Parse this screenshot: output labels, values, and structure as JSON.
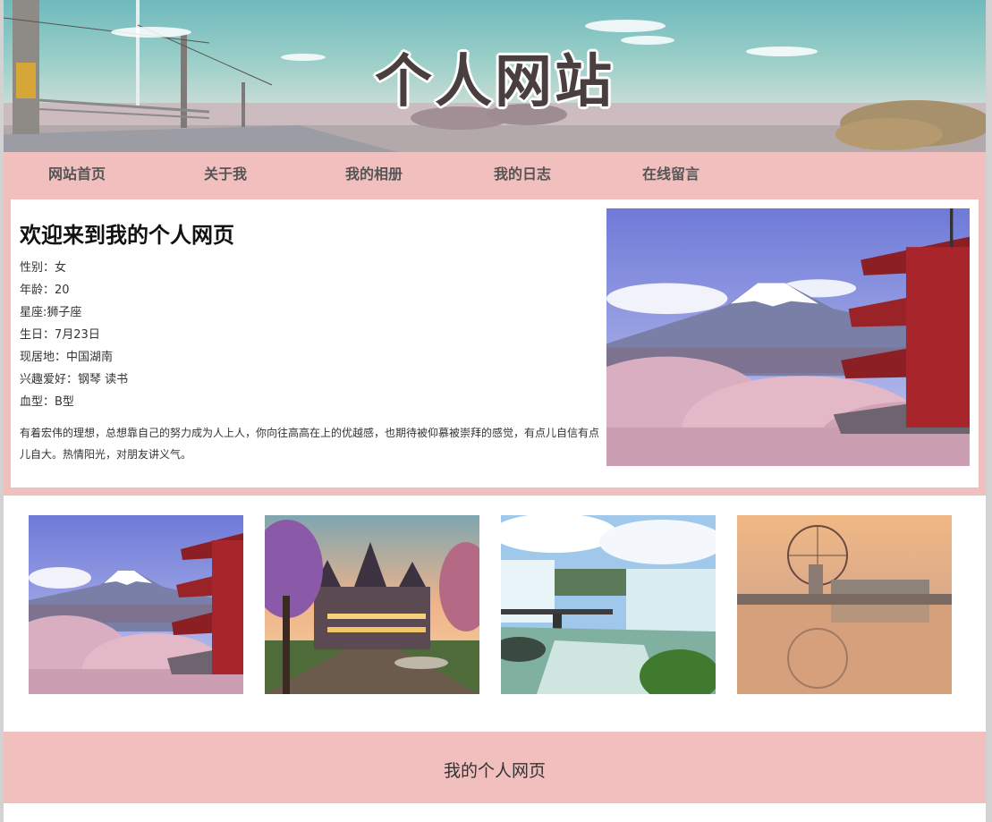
{
  "header": {
    "title": "个人网站"
  },
  "nav": {
    "items": [
      {
        "label": "网站首页"
      },
      {
        "label": "关于我"
      },
      {
        "label": "我的相册"
      },
      {
        "label": "我的日志"
      },
      {
        "label": "在线留言"
      }
    ]
  },
  "intro": {
    "title": "欢迎来到我的个人网页",
    "info": [
      "性别：女",
      "年龄：20",
      "星座:狮子座",
      "生日：7月23日",
      "现居地：中国湖南",
      "兴趣爱好：钢琴 读书",
      "血型：B型"
    ],
    "description": "有着宏伟的理想，总想靠自己的努力成为人上人，你向往高高在上的优越感，也期待被仰慕被崇拜的感觉，有点儿自信有点儿自大。热情阳光，对朋友讲义气。"
  },
  "gallery": {
    "items": [
      {
        "icon": "fuji-pagoda-photo"
      },
      {
        "icon": "castle-painting-photo"
      },
      {
        "icon": "waterfall-photo"
      },
      {
        "icon": "ferris-wheel-photo"
      }
    ]
  },
  "footer": {
    "text": "我的个人网页"
  },
  "colors": {
    "accent": "#f2bfbf",
    "frame": "#d2d2d2"
  }
}
